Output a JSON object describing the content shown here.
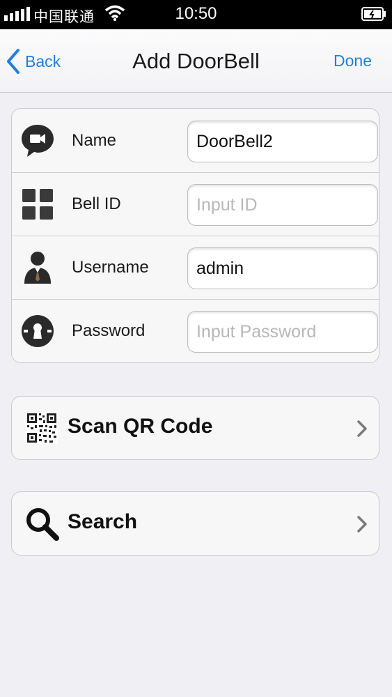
{
  "status_bar": {
    "carrier": "中国联通",
    "time": "10:50"
  },
  "nav": {
    "back_label": "Back",
    "title": "Add DoorBell",
    "done_label": "Done",
    "accent_color": "#1e7fe0"
  },
  "form": {
    "rows": [
      {
        "icon": "chat-bubble-camera-icon",
        "label": "Name",
        "value": "DoorBell2",
        "placeholder": ""
      },
      {
        "icon": "grid-icon",
        "label": "Bell ID",
        "value": "",
        "placeholder": "Input ID"
      },
      {
        "icon": "user-icon",
        "label": "Username",
        "value": "admin",
        "placeholder": ""
      },
      {
        "icon": "keyhole-icon",
        "label": "Password",
        "value": "",
        "placeholder": "Input Password"
      }
    ]
  },
  "actions": {
    "scan_qr": {
      "icon": "qr-code-icon",
      "label": "Scan QR Code"
    },
    "search": {
      "icon": "search-icon",
      "label": "Search"
    }
  }
}
